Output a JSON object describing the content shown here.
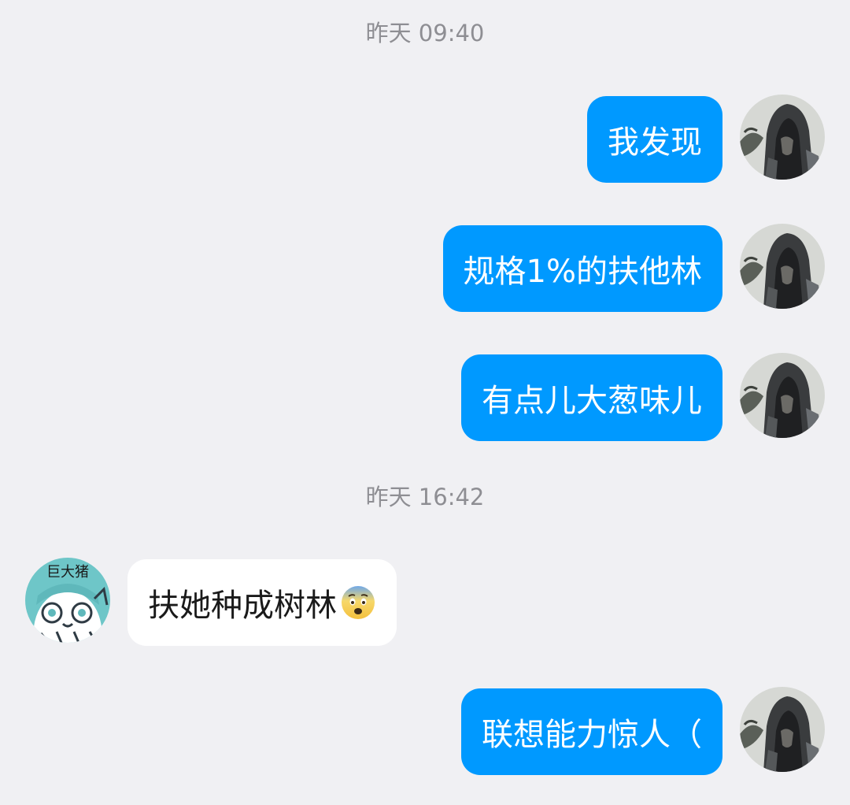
{
  "chat": {
    "timestamps": [
      "昨天 09:40",
      "昨天 16:42"
    ],
    "messages": [
      {
        "sender": "self",
        "text": "我发现"
      },
      {
        "sender": "self",
        "text": "规格1%的扶他林"
      },
      {
        "sender": "self",
        "text": "有点儿大葱味儿"
      },
      {
        "sender": "other",
        "text": "扶她种成树林",
        "emoji": "fearful-face-icon"
      },
      {
        "sender": "self",
        "text": "联想能力惊人（"
      }
    ],
    "other_avatar_label": "巨大猪"
  },
  "colors": {
    "background": "#f0f0f3",
    "outgoing_bubble": "#0099ff",
    "incoming_bubble": "#ffffff",
    "timestamp_text": "#8e8e93"
  }
}
